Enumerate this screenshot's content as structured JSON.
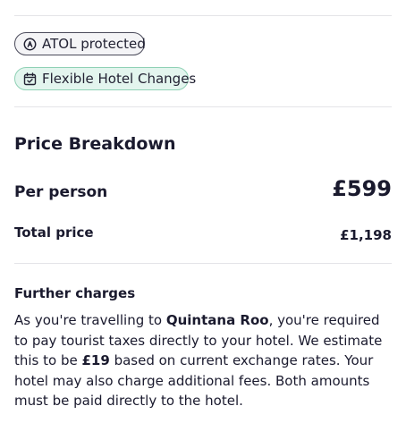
{
  "badges": {
    "atol": {
      "label": "ATOL protected",
      "icon": "atol-shield-icon"
    },
    "flexible": {
      "label": "Flexible Hotel Changes",
      "icon": "calendar-check-icon"
    }
  },
  "price_breakdown": {
    "title": "Price Breakdown",
    "per_person": {
      "label": "Per person",
      "value": "£599"
    },
    "total": {
      "label": "Total price",
      "value": "£1,198"
    }
  },
  "further_charges": {
    "title": "Further charges",
    "text_1": "As you're travelling to ",
    "destination": "Quintana Roo",
    "text_2": ", you're required to pay tourist taxes directly to your hotel. We estimate this to be ",
    "tax_amount": "£19",
    "text_3": " based on current exchange rates. Your hotel may also charge additional fees. Both amounts must be paid directly to the hotel."
  },
  "colors": {
    "text": "#1a1a2e",
    "atol_border": "#4a4a5a",
    "flex_bg": "#e3f5ee",
    "flex_border": "#8fd1b5",
    "divider": "#e4e4e8"
  }
}
